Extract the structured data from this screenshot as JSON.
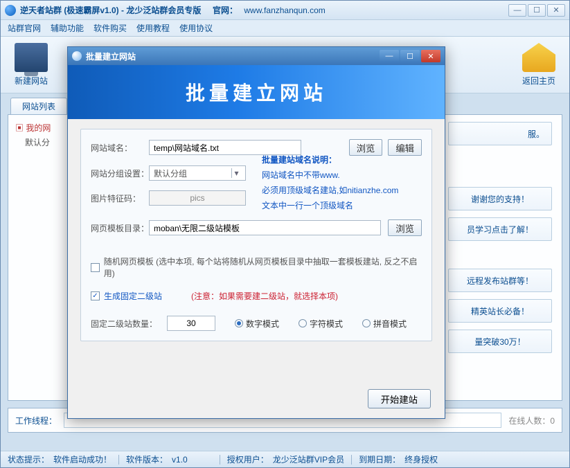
{
  "window": {
    "title_main": "逆天者站群 (极速霸屏v1.0) - 龙少泛站群会员专版",
    "title_site_label": "官网：",
    "title_site_url": "www.fanzhanqun.com"
  },
  "menu": [
    "站群官网",
    "辅助功能",
    "软件购买",
    "使用教程",
    "使用协议"
  ],
  "toolbar": {
    "new_site": "新建网站",
    "back_home": "返回主页"
  },
  "tabs": {
    "site_list": "网站列表"
  },
  "tree": {
    "root": "我的网",
    "child": "默认分"
  },
  "right_links": [
    "服。",
    "谢谢您的支持！",
    "员学习点击了解！",
    "远程发布站群等！",
    "精英站长必备！",
    "量突破30万！"
  ],
  "work": {
    "label": "工作线程：",
    "online": "在线人数：0"
  },
  "status": {
    "tip_label": "状态提示：",
    "tip_value": "软件启动成功！",
    "ver_label": "软件版本：",
    "ver_value": "v1.0",
    "user_label": "授权用户：",
    "user_value": "龙少泛站群VIP会员",
    "exp_label": "到期日期：",
    "exp_value": "终身授权"
  },
  "dialog": {
    "title": "批量建立网站",
    "banner": "批量建立网站",
    "domain_label": "网站域名：",
    "domain_value": "temp\\网站域名.txt",
    "browse": "浏览",
    "edit": "编辑",
    "group_label": "网站分组设置：",
    "group_value": "默认分组",
    "piccode_label": "图片特征码：",
    "piccode_value": "pics",
    "tpl_label": "网页模板目录：",
    "tpl_value": "moban\\无限二级站模板",
    "hint_title": "批量建站域名说明：",
    "hint_1": "网站域名中不带www.",
    "hint_2": "必须用顶级域名建站,如nitianzhe.com",
    "hint_3": "文本中一行一个顶级域名",
    "chk_random": "随机网页模板 (选中本项, 每个站将随机从网页模板目录中抽取一套模板建站, 反之不启用)",
    "chk_fixed": "生成固定二级站",
    "fixed_note": "(注意：如果需要建二级站，就选择本项)",
    "count_label": "固定二级站数量：",
    "count_value": "30",
    "mode_num": "数字模式",
    "mode_char": "字符模式",
    "mode_py": "拼音模式",
    "start": "开始建站"
  }
}
